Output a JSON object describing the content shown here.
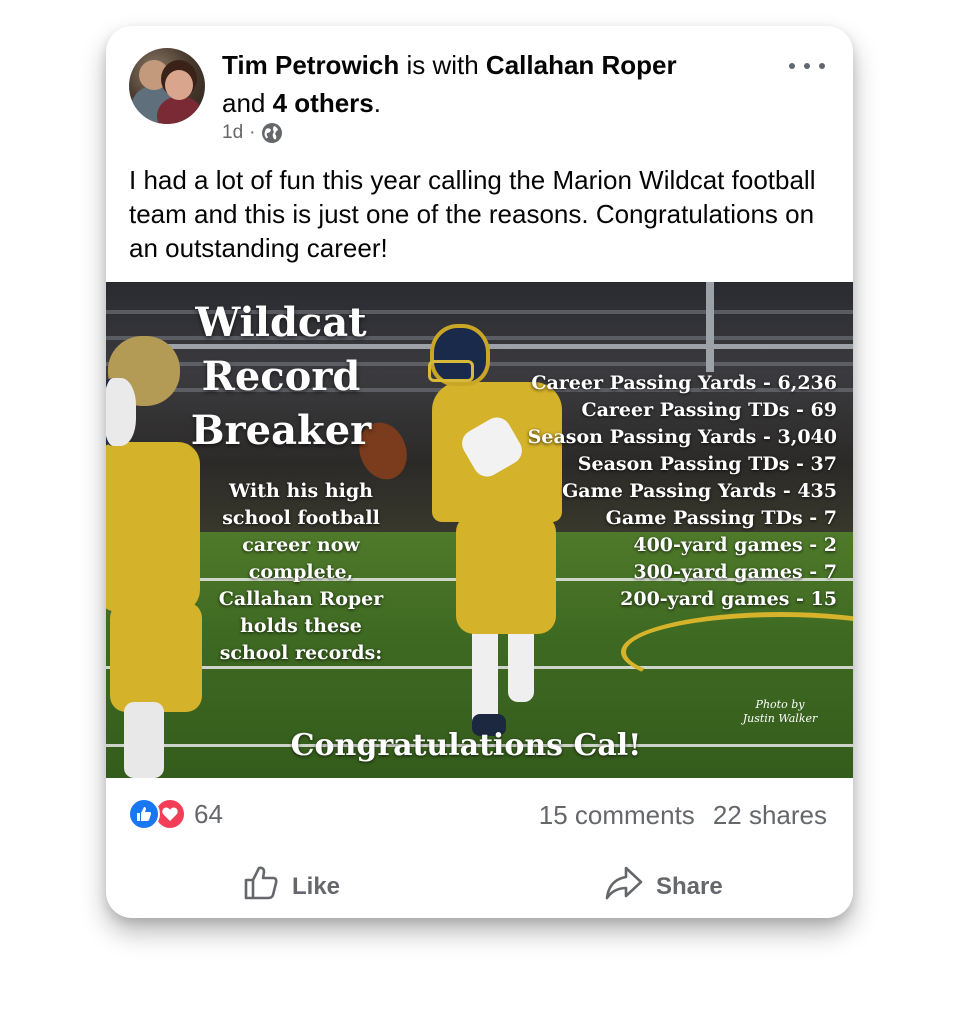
{
  "post": {
    "author": "Tim Petrowich",
    "with_text": " is with ",
    "tagged": "Callahan Roper",
    "and_text": "and ",
    "others": "4 others",
    "period": ".",
    "time": "1d",
    "separator": "·",
    "privacy_icon": "globe-icon",
    "more_icon": "more-horizontal-icon",
    "text": "I had a lot of fun this year calling the Marion Wildcat football team and this is just one of the reasons. Congratulations on an outstanding career!"
  },
  "image": {
    "title_lines": [
      "Wildcat",
      "Record",
      "Breaker"
    ],
    "intro_lines": [
      "With his high",
      "school football",
      "career now complete,",
      "Callahan Roper",
      "holds these",
      "school records:"
    ],
    "records": [
      "Career Passing Yards - 6,236",
      "Career Passing TDs - 69",
      "Season Passing Yards - 3,040",
      "Season Passing TDs - 37",
      "Game Passing Yards - 435",
      "Game Passing TDs - 7",
      "400-yard games - 2",
      "300-yard games - 7",
      "200-yard games - 15"
    ],
    "credit_lines": [
      "Photo by",
      "Justin Walker"
    ],
    "congrats": "Congratulations Cal!"
  },
  "stats": {
    "reaction_icons": [
      "like-reaction-icon",
      "love-reaction-icon"
    ],
    "reaction_count": "64",
    "comments": "15 comments",
    "shares": "22 shares"
  },
  "actions": {
    "like": "Like",
    "share": "Share"
  },
  "colors": {
    "facebook_blue": "#1877f2",
    "love_red": "#f33e58",
    "secondary_text": "#65676b",
    "team_gold": "#d4b229",
    "team_navy": "#1a2a4a"
  }
}
